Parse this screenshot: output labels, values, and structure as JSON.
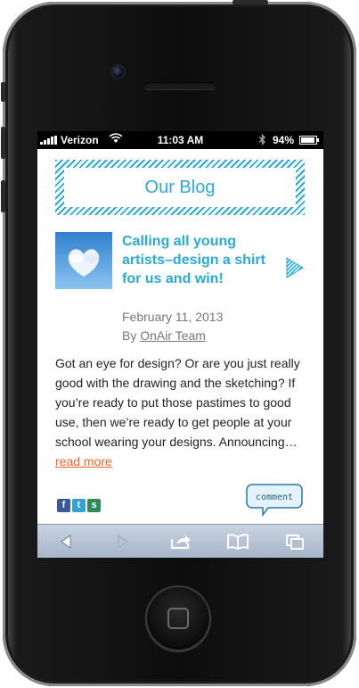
{
  "status_bar": {
    "carrier": "Verizon",
    "time": "11:03 AM",
    "battery": "94%",
    "battery_level": 0.94
  },
  "blog": {
    "title": "Our Blog"
  },
  "post": {
    "title": "Calling all young artists–design a shirt for us and win!",
    "date": "February 11, 2013",
    "author_prefix": "By",
    "author": "OnAir Team",
    "excerpt": "Got an eye for design? Or are you just really good with the drawing and the sketching? If you’re ready to put those pastimes to good use, then we’re ready to get people at your school wearing your designs. Announcing…",
    "read_more": "read more",
    "comment_label": "comment"
  },
  "share": {
    "facebook": "f",
    "twitter": "t",
    "share": "s"
  },
  "toolbar": {
    "icons": [
      "back-icon",
      "forward-icon",
      "share-icon",
      "bookmarks-icon",
      "tabs-icon"
    ]
  },
  "colors": {
    "accent": "#2aa9dc",
    "link": "#f26522",
    "meta": "#777777"
  }
}
